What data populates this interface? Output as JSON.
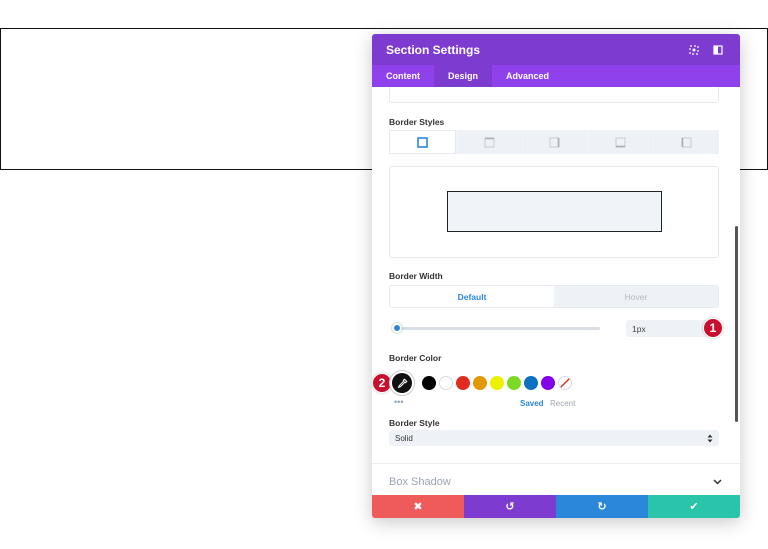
{
  "panel": {
    "title": "Section Settings",
    "tabs": [
      {
        "label": "Content",
        "active": false
      },
      {
        "label": "Design",
        "active": true
      },
      {
        "label": "Advanced",
        "active": false
      }
    ]
  },
  "border_styles": {
    "label": "Border Styles",
    "tabs": [
      "all-sides",
      "top",
      "right",
      "bottom",
      "left"
    ],
    "active_tab": "all-sides"
  },
  "border_width": {
    "label": "Border Width",
    "toggle": {
      "default": "Default",
      "hover": "Hover",
      "active": "Default"
    },
    "value": "1px",
    "slider_fraction": 0.03
  },
  "border_color": {
    "label": "Border Color",
    "selected": "#000000",
    "swatches": [
      "#000000",
      "#ffffff",
      "#e02b20",
      "#e09900",
      "#edf000",
      "#7cda24",
      "#0c71c3",
      "#8300e9",
      "none"
    ],
    "more": "•••",
    "saved_label": "Saved",
    "recent_label": "Recent"
  },
  "border_style": {
    "label": "Border Style",
    "value": "Solid"
  },
  "box_shadow": {
    "label": "Box Shadow"
  },
  "callouts": [
    "1",
    "2"
  ],
  "footer": {
    "buttons": [
      {
        "name": "discard",
        "glyph": "✖",
        "color": "#ef5b5b"
      },
      {
        "name": "undo",
        "glyph": "↺",
        "color": "#7e3bd0"
      },
      {
        "name": "redo",
        "glyph": "↻",
        "color": "#2b87da"
      },
      {
        "name": "save",
        "glyph": "✔",
        "color": "#29c4a9"
      }
    ]
  },
  "colors": {
    "header": "#7e3bd0",
    "tabs_bar": "#8f42ec",
    "accent": "#2b87da",
    "callout": "#c8102e"
  }
}
